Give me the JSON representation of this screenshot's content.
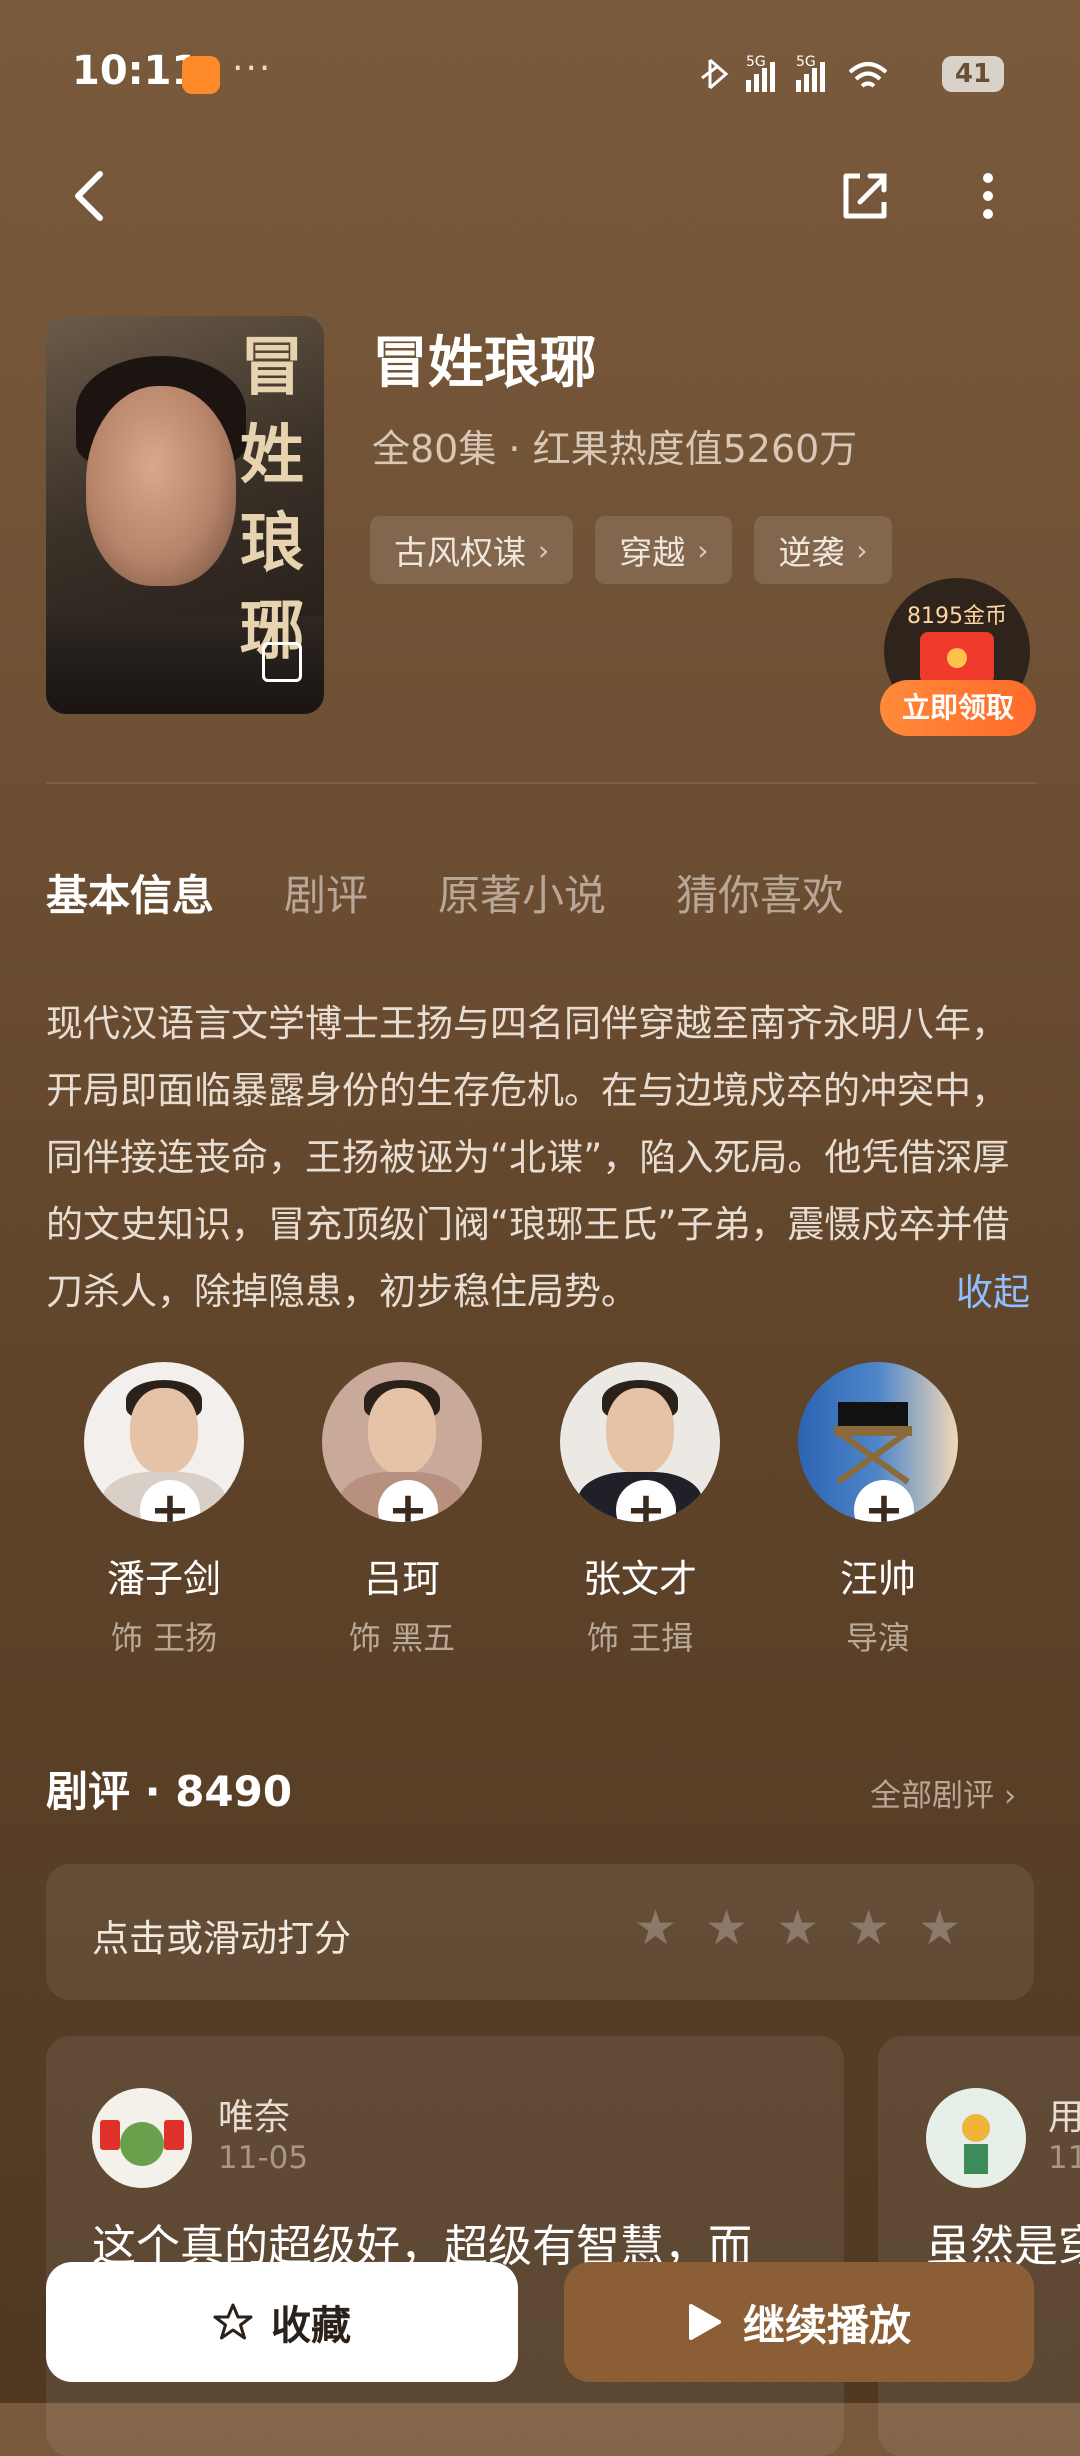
{
  "status": {
    "time": "10:11",
    "dots": "···",
    "network": "5G 5G",
    "battery": "41"
  },
  "drama": {
    "title": "冒姓琅琊",
    "meta": "全80集 · 红果热度值5260万",
    "poster_title": "冒姓琅琊",
    "tags": [
      "古风权谋",
      "穿越",
      "逆袭"
    ]
  },
  "reward": {
    "coins": "8195金币",
    "button": "立即领取"
  },
  "tabs": [
    "基本信息",
    "剧评",
    "原著小说",
    "猜你喜欢"
  ],
  "description": "现代汉语言文学博士王扬与四名同伴穿越至南齐永明八年，开局即面临暴露身份的生存危机。在与边境戍卒的冲突中，同伴接连丧命，王扬被诬为“北谍”，陷入死局。他凭借深厚的文史知识，冒充顶级门阀“琅琊王氏”子弟，震慑戍卒并借刀杀人，除掉隐患，初步稳住局势。",
  "collapse": "收起",
  "cast": [
    {
      "name": "潘子剑",
      "role": "饰 王扬"
    },
    {
      "name": "吕珂",
      "role": "饰 黑五"
    },
    {
      "name": "张文才",
      "role": "饰 王揖"
    },
    {
      "name": "汪帅",
      "role": "导演"
    }
  ],
  "reviews": {
    "heading": "剧评 · 8490",
    "all": "全部剧评",
    "rate_label": "点击或滑动打分",
    "cards": [
      {
        "name": "唯奈",
        "date": "11-05",
        "text": "这个真的超级好，超级有智慧，而"
      },
      {
        "name": "用",
        "date": "11",
        "text": "虽然是穿"
      }
    ]
  },
  "bottom": {
    "favorite": "收藏",
    "play": "继续播放"
  }
}
